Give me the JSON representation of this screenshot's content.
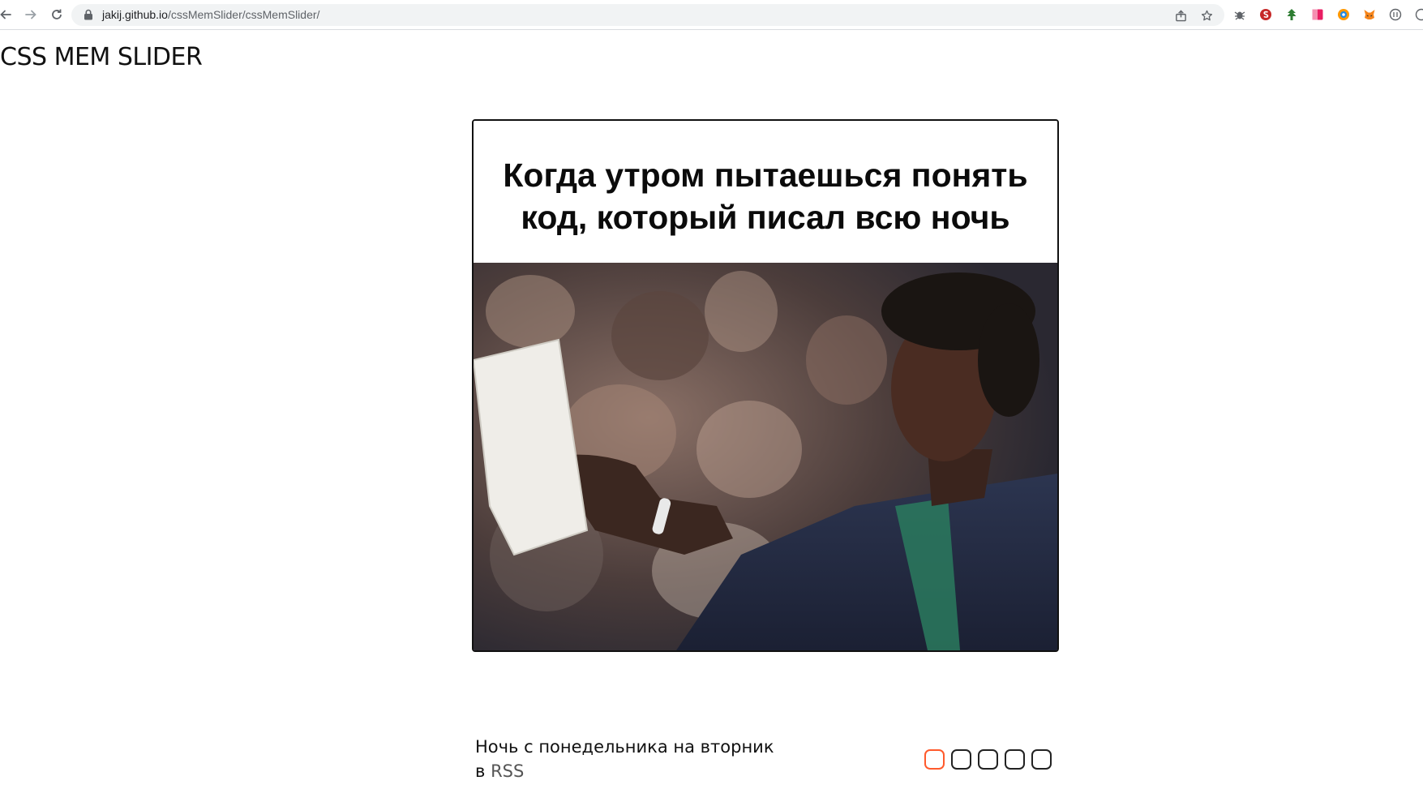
{
  "browser": {
    "url_host": "jakij.github.io",
    "url_path": "/cssMemSlider/cssMemSlider/",
    "nav": {
      "back": "back-arrow-icon",
      "forward": "forward-arrow-icon",
      "reload": "reload-icon"
    },
    "omnibox_icons": [
      "share-icon",
      "bookmark-star-icon"
    ],
    "extensions": [
      "bug-extension-icon",
      "red-s-extension-icon",
      "green-tree-extension-icon",
      "pink-square-extension-icon",
      "color-picker-extension-icon",
      "metamask-fox-extension-icon",
      "circle-extension-icon"
    ]
  },
  "page": {
    "title": "CSS MEM SLIDER"
  },
  "slide": {
    "meme_line_1": "Когда утром пытаешься понять",
    "meme_line_2": "код, который писал всю ночь",
    "caption": "Ночь с понедельника на вторник",
    "caption_prefix": "в",
    "caption_link": "RSS"
  },
  "pagination": {
    "count": 5,
    "active_index": 0,
    "active_color": "#ff5a2c"
  }
}
